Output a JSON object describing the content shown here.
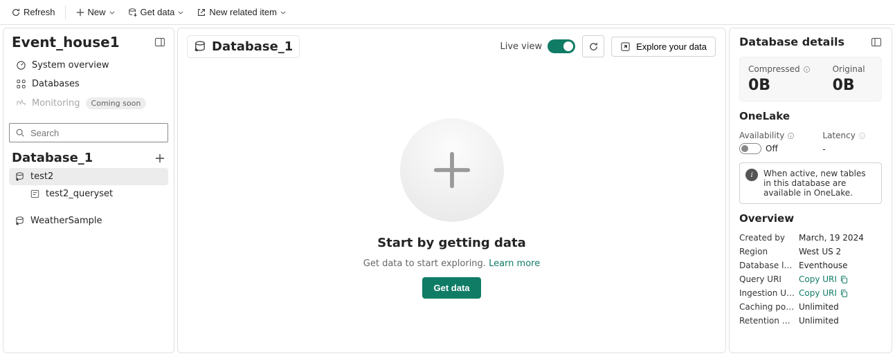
{
  "toolbar": {
    "refresh": "Refresh",
    "new": "New",
    "get_data": "Get data",
    "new_related": "New related item"
  },
  "left": {
    "eventhouse_name": "Event_house1",
    "nav": {
      "system_overview": "System overview",
      "databases": "Databases",
      "monitoring": "Monitoring",
      "coming_soon": "Coming soon"
    },
    "search_placeholder": "Search",
    "database_name": "Database_1",
    "tree": {
      "test2": "test2",
      "test2_queryset": "test2_queryset",
      "weather_sample": "WeatherSample"
    }
  },
  "center": {
    "db_name": "Database_1",
    "live_view_label": "Live view",
    "explore_label": "Explore your data",
    "empty_title": "Start by getting data",
    "empty_sub": "Get data to start exploring.",
    "learn_more": "Learn more",
    "cta_label": "Get data"
  },
  "right": {
    "title": "Database details",
    "compressed_label": "Compressed",
    "compressed_value": "0B",
    "original_label": "Original",
    "original_value": "0B",
    "onelake_title": "OneLake",
    "availability_label": "Availability",
    "availability_value": "Off",
    "latency_label": "Latency",
    "latency_value": "-",
    "info_text": "When active, new tables in this database are available in OneLake.",
    "overview_title": "Overview",
    "kv": {
      "created_by_k": "Created by",
      "created_by_v": "March, 19 2024",
      "region_k": "Region",
      "region_v": "West US 2",
      "dblocation_k": "Database locati…",
      "dblocation_v": "Eventhouse",
      "queryuri_k": "Query URI",
      "queryuri_v": "Copy URI",
      "ingestion_k": "Ingestion URL",
      "ingestion_v": "Copy URI",
      "caching_k": "Caching policy",
      "caching_v": "Unlimited",
      "retention_k": "Retention policy",
      "retention_v": "Unlimited"
    }
  }
}
